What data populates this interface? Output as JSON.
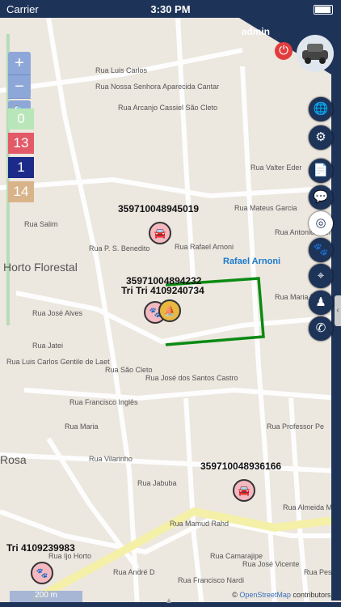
{
  "status_bar": {
    "carrier": "Carrier",
    "time": "3:30 PM"
  },
  "user": {
    "name": "admin"
  },
  "zoom": {
    "in": "+",
    "out": "−"
  },
  "counts": [
    {
      "value": "0",
      "color": "#b9e6b9"
    },
    {
      "value": "13",
      "color": "#e25a68"
    },
    {
      "value": "1",
      "color": "#1c2a8a"
    },
    {
      "value": "14",
      "color": "#d9b48a"
    }
  ],
  "map_labels": {
    "area": [
      "Horto Florestal",
      "Rosa"
    ],
    "streets": [
      "Rua Luis Carlos",
      "Rua Nossa Senhora Aparecida Cantar",
      "Rua Arcanjo Cassiel São Cleto",
      "Rua P. S. Benedito",
      "Rua Luis Carlos Gentile de Laet",
      "Rua José Alves",
      "Rua Jatei",
      "Rua Francisco Inglês",
      "Rua São Cleto",
      "Rua José dos Santos Castro",
      "Rua Mateus Garcia",
      "Rua Rafael Arnoni",
      "Rua Valter Eder",
      "Rua Antonio Marmo",
      "Rua Maria Ro",
      "Rua Professor Pe",
      "Rua Almeida Meres",
      "Rua Mamud Rahd",
      "Rua Jabuba",
      "Rua Vilarinho",
      "Rua Maria",
      "Rua Camarajipe",
      "Rua José Vicente",
      "Rua Pestana",
      "Rua André D",
      "Rua Francisco Nardi",
      "Rua Ijo Horto",
      "Rua Salim"
    ],
    "route": "Rafael Arnoni"
  },
  "vehicles": [
    {
      "label": "359710048945019",
      "icon": "car-icon"
    },
    {
      "label": "35971004894232",
      "icon": "car-icon"
    },
    {
      "label": "Tri Tri 4109240734",
      "icon": "paw-icon"
    },
    {
      "label": "359710048936166",
      "icon": "car-icon"
    },
    {
      "label": "Tri 4109239983",
      "icon": "paw-icon"
    }
  ],
  "scale": "200 m",
  "attribution": {
    "prefix": "©",
    "link": "OpenStreetMap",
    "suffix": "contributors."
  },
  "side_buttons": [
    "globe-icon",
    "gear-icon",
    "document-icon",
    "chat-icon",
    "target-icon",
    "paw-icon",
    "crosshair-icon",
    "person-icon",
    "whatsapp-icon"
  ]
}
